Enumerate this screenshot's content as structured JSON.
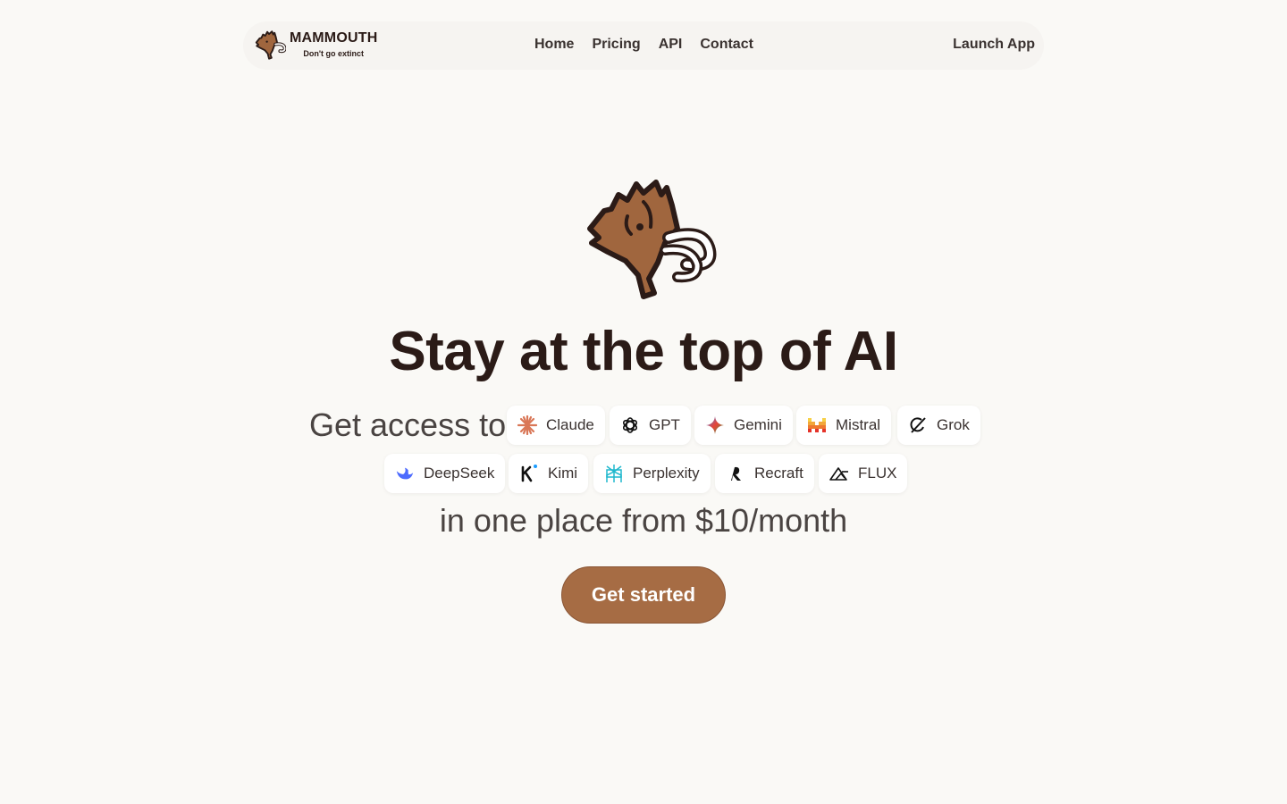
{
  "nav": {
    "brand_name": "MAMMOUTH",
    "brand_tagline": "Don't go extinct",
    "links": [
      "Home",
      "Pricing",
      "API",
      "Contact"
    ],
    "launch_label": "Launch App"
  },
  "hero": {
    "headline": "Stay at the top of AI",
    "access_label": "Get access to",
    "models_row1": [
      "Claude",
      "GPT",
      "Gemini",
      "Mistral",
      "Grok"
    ],
    "models_row2": [
      "DeepSeek",
      "Kimi",
      "Perplexity",
      "Recraft",
      "FLUX"
    ],
    "subline": "in one place from $10/month",
    "cta_label": "Get started"
  },
  "icons": {
    "claude": "claude-logo-icon",
    "gpt": "openai-logo-icon",
    "gemini": "gemini-logo-icon",
    "mistral": "mistral-logo-icon",
    "grok": "grok-logo-icon",
    "deepseek": "deepseek-logo-icon",
    "kimi": "kimi-logo-icon",
    "perplexity": "perplexity-logo-icon",
    "recraft": "recraft-logo-icon",
    "flux": "flux-logo-icon"
  },
  "colors": {
    "background": "#faf9f6",
    "nav_background": "#f6f4f1",
    "text_dark": "#2b1b17",
    "accent": "#a66c44",
    "mammoth_fur": "#a0663e"
  }
}
